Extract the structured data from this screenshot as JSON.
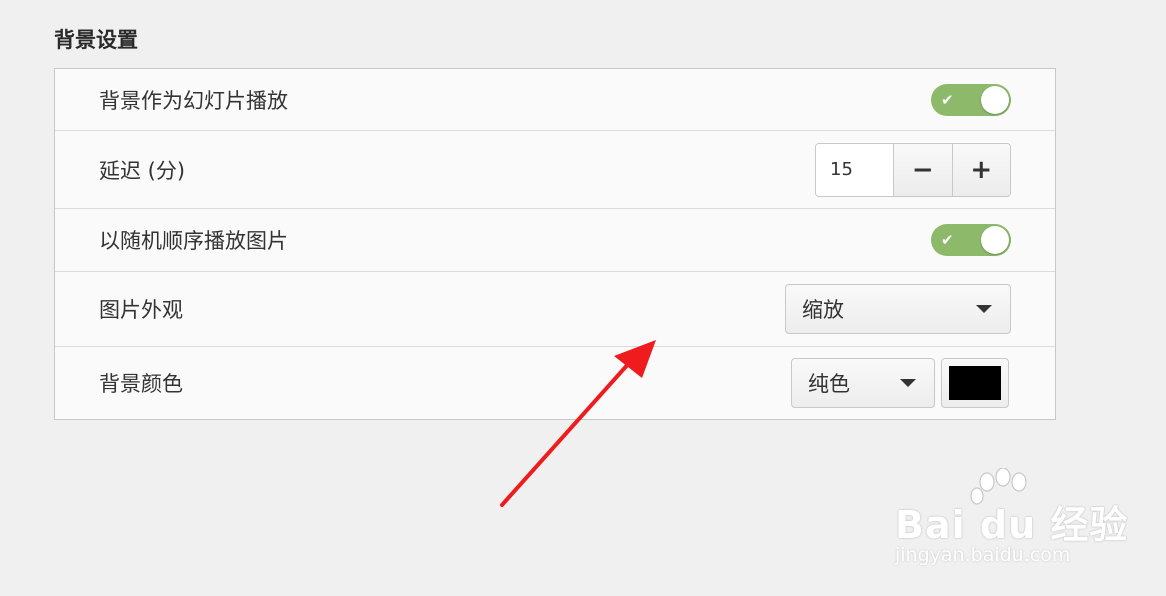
{
  "section": {
    "title": "背景设置"
  },
  "rows": {
    "slideshow": {
      "label": "背景作为幻灯片播放",
      "enabled": true,
      "check": "✔"
    },
    "delay": {
      "label": "延迟 (分)",
      "value": "15",
      "minus": "−",
      "plus": "+"
    },
    "random": {
      "label": "以随机顺序播放图片",
      "enabled": true,
      "check": "✔"
    },
    "appearance": {
      "label": "图片外观",
      "selected": "缩放"
    },
    "color": {
      "label": "背景颜色",
      "selected": "纯色",
      "swatch": "#000000"
    }
  },
  "colors": {
    "toggle_on": "#8dba6a",
    "annotation_arrow": "#ee1c1c"
  },
  "watermark": {
    "brand": "Bai du 经验",
    "domain": "jingyan.baidu.com"
  }
}
